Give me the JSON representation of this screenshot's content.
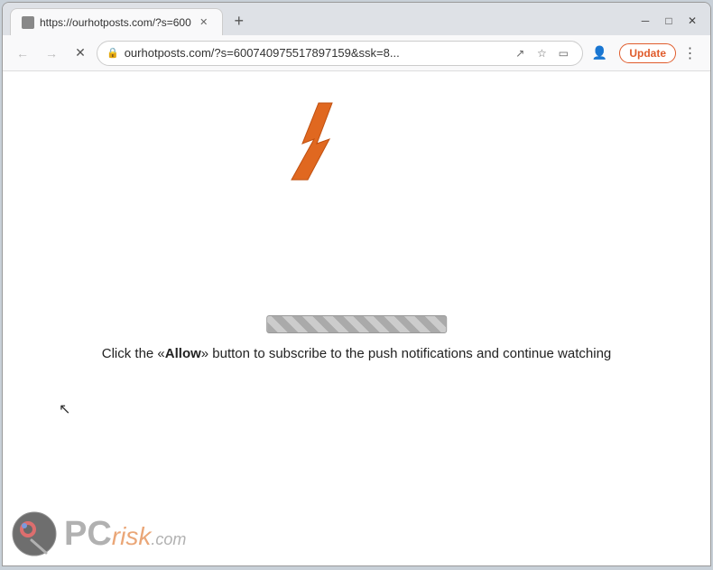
{
  "browser": {
    "title_bar": {
      "tab_title": "https://ourhotposts.com/?s=600",
      "new_tab_label": "+",
      "window_controls": {
        "minimize": "─",
        "maximize": "□",
        "close": "✕"
      }
    },
    "nav_bar": {
      "back_label": "←",
      "forward_label": "→",
      "reload_label": "✕",
      "address": "ourhotposts.com/?s=600740975517897159&ssk=8...",
      "share_label": "↗",
      "bookmark_label": "☆",
      "sidebar_label": "▭",
      "profile_label": "👤",
      "update_label": "Update",
      "more_label": "⋮"
    },
    "content": {
      "cta_text_pre": "Click the «",
      "cta_allow": "Allow",
      "cta_text_post": "» button to subscribe to the push notifications and continue watching"
    }
  },
  "watermark": {
    "pc_text": "PC",
    "risk_text": "risk",
    "com_text": ".com"
  }
}
